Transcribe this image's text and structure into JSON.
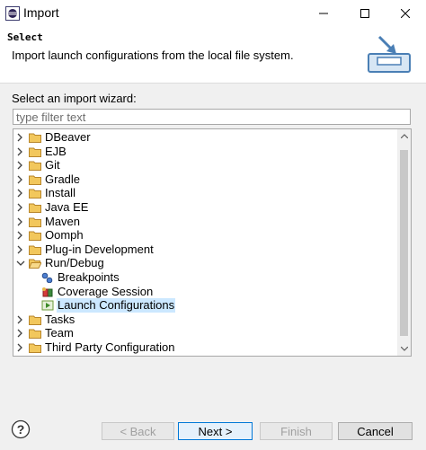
{
  "window": {
    "title": "Import"
  },
  "header": {
    "title": "Select",
    "description": "Import launch configurations from the local file system."
  },
  "wizard": {
    "label": "Select an import wizard:",
    "filter_placeholder": "type filter text",
    "tree": [
      {
        "label": "DBeaver",
        "icon": "folder-icon",
        "expanded": false
      },
      {
        "label": "EJB",
        "icon": "folder-icon",
        "expanded": false
      },
      {
        "label": "Git",
        "icon": "folder-icon",
        "expanded": false
      },
      {
        "label": "Gradle",
        "icon": "folder-icon",
        "expanded": false
      },
      {
        "label": "Install",
        "icon": "folder-icon",
        "expanded": false
      },
      {
        "label": "Java EE",
        "icon": "folder-icon",
        "expanded": false
      },
      {
        "label": "Maven",
        "icon": "folder-icon",
        "expanded": false
      },
      {
        "label": "Oomph",
        "icon": "folder-icon",
        "expanded": false
      },
      {
        "label": "Plug-in Development",
        "icon": "folder-icon",
        "expanded": false
      },
      {
        "label": "Run/Debug",
        "icon": "folder-open-icon",
        "expanded": true
      },
      {
        "label": "Breakpoints",
        "icon": "breakpoints-icon",
        "child": true
      },
      {
        "label": "Coverage Session",
        "icon": "coverage-icon",
        "child": true
      },
      {
        "label": "Launch Configurations",
        "icon": "launch-config-icon",
        "child": true,
        "selected": true
      },
      {
        "label": "Tasks",
        "icon": "folder-icon",
        "expanded": false
      },
      {
        "label": "Team",
        "icon": "folder-icon",
        "expanded": false
      },
      {
        "label": "Third Party Configuration",
        "icon": "folder-icon",
        "expanded": false
      }
    ]
  },
  "buttons": {
    "back": "< Back",
    "next": "Next >",
    "finish": "Finish",
    "cancel": "Cancel"
  },
  "colors": {
    "selection": "#cce8ff",
    "folder": "#e8b84a",
    "accent": "#0078d7"
  }
}
